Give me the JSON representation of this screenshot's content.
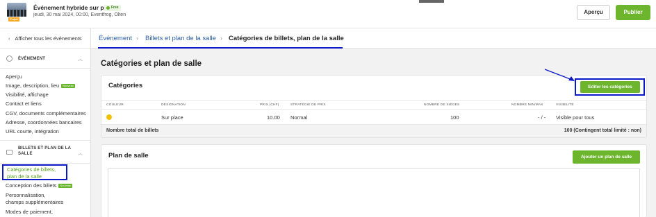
{
  "header": {
    "event_title": "Événement hybride sur place",
    "free_badge": "Free",
    "event_subtitle": "jeudi, 30 mai 2024, 00:00, Eventfrog, Olten",
    "thumb_badge": "Projet",
    "preview_label": "Aperçu",
    "publish_label": "Publier"
  },
  "sidebar": {
    "back_label": "Afficher tous les événements",
    "section_event": "ÉVÉNEMENT",
    "event_items": [
      {
        "label": "Aperçu"
      },
      {
        "label": "Image, description, lieu",
        "badge": "Nouveau"
      },
      {
        "label": "Visibilité, affichage"
      },
      {
        "label": "Contact et liens"
      },
      {
        "label": "CGV, documents complémentaires"
      },
      {
        "label": "Adresse, coordonnées bancaires"
      },
      {
        "label": "URL courte, intégration"
      }
    ],
    "section_tickets_line1": "BILLETS ET PLAN DE LA",
    "section_tickets_line2": "SALLE",
    "active_item_line1": "Catégories de billets,",
    "active_item_line2": "plan de la salle",
    "ticket_items": [
      {
        "label": "Conception des billets",
        "badge": "Nouveau"
      },
      {
        "label_line1": "Personnalisation,",
        "label_line2": "champs supplémentaires"
      },
      {
        "label": "Modes de paiement,"
      }
    ]
  },
  "breadcrumb": {
    "items": [
      "Événement",
      "Billets et plan de la salle",
      "Catégories de billets, plan de la salle"
    ],
    "separator": "›"
  },
  "page_title": "Catégories et plan de salle",
  "categories": {
    "title": "Catégories",
    "edit_label": "Editer les catégories",
    "columns": [
      "COULEUR",
      "DÉSIGNATION",
      "PRIX (CHF)",
      "STRATÉGIE DE PRIX",
      "NOMBRE DE SIÈGES",
      "NOMBRE MIN/MAX",
      "VISIBILITÉ"
    ],
    "rows": [
      {
        "color": "#f2c200",
        "designation": "Sur place",
        "price": "10.00",
        "strategy": "Normal",
        "seats": "100",
        "minmax": "- / -",
        "visibility": "Visible pour tous"
      }
    ],
    "total_label": "Nombre total de billets",
    "total_value": "100 (Contingent total limité : non)"
  },
  "seating_plan": {
    "title": "Plan de salle",
    "add_label": "Ajouter un plan de salle"
  },
  "colors": {
    "accent_green": "#6cb52d",
    "link_blue": "#2b5fa6",
    "highlight_blue": "#0a18c7"
  }
}
